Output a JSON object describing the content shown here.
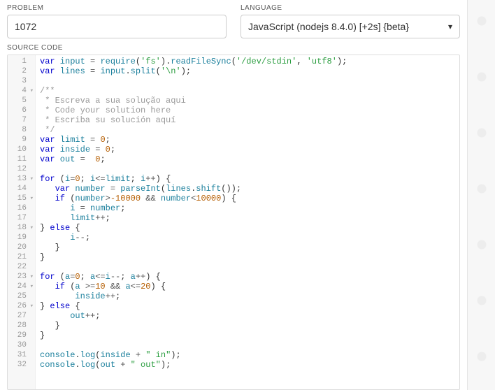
{
  "labels": {
    "problem": "PROBLEM",
    "language": "LANGUAGE",
    "source": "SOURCE CODE"
  },
  "problem_value": "1072",
  "language_value": "JavaScript (nodejs 8.4.0) [+2s] {beta}",
  "code_lines": [
    {
      "n": 1,
      "fold": false,
      "tokens": [
        [
          "kw",
          "var"
        ],
        [
          "",
          ""
        ],
        [
          "id",
          " input "
        ],
        [
          "op",
          "= "
        ],
        [
          "fn",
          "require"
        ],
        [
          "pun",
          "("
        ],
        [
          "str",
          "'fs'"
        ],
        [
          "pun",
          ")."
        ],
        [
          "fn",
          "readFileSync"
        ],
        [
          "pun",
          "("
        ],
        [
          "str",
          "'/dev/stdin'"
        ],
        [
          "pun",
          ", "
        ],
        [
          "str",
          "'utf8'"
        ],
        [
          "pun",
          ");"
        ]
      ]
    },
    {
      "n": 2,
      "fold": false,
      "tokens": [
        [
          "kw",
          "var"
        ],
        [
          "id",
          " lines "
        ],
        [
          "op",
          "= "
        ],
        [
          "id",
          "input"
        ],
        [
          "pun",
          "."
        ],
        [
          "fn",
          "split"
        ],
        [
          "pun",
          "("
        ],
        [
          "str",
          "'\\n'"
        ],
        [
          "pun",
          ");"
        ]
      ]
    },
    {
      "n": 3,
      "fold": false,
      "tokens": []
    },
    {
      "n": 4,
      "fold": true,
      "tokens": [
        [
          "cmt",
          "/**"
        ]
      ]
    },
    {
      "n": 5,
      "fold": false,
      "tokens": [
        [
          "cmt",
          " * Escreva a sua solução aqui"
        ]
      ]
    },
    {
      "n": 6,
      "fold": false,
      "tokens": [
        [
          "cmt",
          " * Code your solution here"
        ]
      ]
    },
    {
      "n": 7,
      "fold": false,
      "tokens": [
        [
          "cmt",
          " * Escriba su solución aquí"
        ]
      ]
    },
    {
      "n": 8,
      "fold": false,
      "tokens": [
        [
          "cmt",
          " */"
        ]
      ]
    },
    {
      "n": 9,
      "fold": false,
      "tokens": [
        [
          "kw",
          "var"
        ],
        [
          "id",
          " limit "
        ],
        [
          "op",
          "= "
        ],
        [
          "num",
          "0"
        ],
        [
          "pun",
          ";"
        ]
      ]
    },
    {
      "n": 10,
      "fold": false,
      "tokens": [
        [
          "kw",
          "var"
        ],
        [
          "id",
          " inside "
        ],
        [
          "op",
          "= "
        ],
        [
          "num",
          "0"
        ],
        [
          "pun",
          ";"
        ]
      ]
    },
    {
      "n": 11,
      "fold": false,
      "tokens": [
        [
          "kw",
          "var"
        ],
        [
          "id",
          " out "
        ],
        [
          "op",
          "=  "
        ],
        [
          "num",
          "0"
        ],
        [
          "pun",
          ";"
        ]
      ]
    },
    {
      "n": 12,
      "fold": false,
      "tokens": []
    },
    {
      "n": 13,
      "fold": true,
      "tokens": [
        [
          "kw",
          "for"
        ],
        [
          "pun",
          " ("
        ],
        [
          "id",
          "i"
        ],
        [
          "op",
          "="
        ],
        [
          "num",
          "0"
        ],
        [
          "pun",
          "; "
        ],
        [
          "id",
          "i"
        ],
        [
          "op",
          "<="
        ],
        [
          "id",
          "limit"
        ],
        [
          "pun",
          "; "
        ],
        [
          "id",
          "i"
        ],
        [
          "op",
          "++"
        ],
        [
          "pun",
          ") {"
        ]
      ]
    },
    {
      "n": 14,
      "fold": false,
      "tokens": [
        [
          "",
          "   "
        ],
        [
          "kw",
          "var"
        ],
        [
          "id",
          " number "
        ],
        [
          "op",
          "= "
        ],
        [
          "fn",
          "parseInt"
        ],
        [
          "pun",
          "("
        ],
        [
          "id",
          "lines"
        ],
        [
          "pun",
          "."
        ],
        [
          "fn",
          "shift"
        ],
        [
          "pun",
          "());"
        ]
      ]
    },
    {
      "n": 15,
      "fold": true,
      "tokens": [
        [
          "",
          "   "
        ],
        [
          "kw",
          "if"
        ],
        [
          "pun",
          " ("
        ],
        [
          "id",
          "number"
        ],
        [
          "op",
          ">"
        ],
        [
          "num",
          "-10000"
        ],
        [
          "op",
          " && "
        ],
        [
          "id",
          "number"
        ],
        [
          "op",
          "<"
        ],
        [
          "num",
          "10000"
        ],
        [
          "pun",
          ") {"
        ]
      ]
    },
    {
      "n": 16,
      "fold": false,
      "tokens": [
        [
          "",
          "      "
        ],
        [
          "id",
          "i "
        ],
        [
          "op",
          "= "
        ],
        [
          "id",
          "number"
        ],
        [
          "pun",
          ";"
        ]
      ]
    },
    {
      "n": 17,
      "fold": false,
      "tokens": [
        [
          "",
          "      "
        ],
        [
          "id",
          "limit"
        ],
        [
          "op",
          "++"
        ],
        [
          "pun",
          ";"
        ]
      ]
    },
    {
      "n": 18,
      "fold": true,
      "tokens": [
        [
          "pun",
          "} "
        ],
        [
          "kw",
          "else"
        ],
        [
          "pun",
          " {"
        ]
      ]
    },
    {
      "n": 19,
      "fold": false,
      "tokens": [
        [
          "",
          "      "
        ],
        [
          "id",
          "i"
        ],
        [
          "op",
          "--"
        ],
        [
          "pun",
          ";"
        ]
      ]
    },
    {
      "n": 20,
      "fold": false,
      "tokens": [
        [
          "",
          "   "
        ],
        [
          "pun",
          "}"
        ]
      ]
    },
    {
      "n": 21,
      "fold": false,
      "tokens": [
        [
          "pun",
          "}"
        ]
      ]
    },
    {
      "n": 22,
      "fold": false,
      "tokens": []
    },
    {
      "n": 23,
      "fold": true,
      "tokens": [
        [
          "kw",
          "for"
        ],
        [
          "pun",
          " ("
        ],
        [
          "id",
          "a"
        ],
        [
          "op",
          "="
        ],
        [
          "num",
          "0"
        ],
        [
          "pun",
          "; "
        ],
        [
          "id",
          "a"
        ],
        [
          "op",
          "<="
        ],
        [
          "id",
          "i"
        ],
        [
          "op",
          "--"
        ],
        [
          "pun",
          "; "
        ],
        [
          "id",
          "a"
        ],
        [
          "op",
          "++"
        ],
        [
          "pun",
          ") {"
        ]
      ]
    },
    {
      "n": 24,
      "fold": true,
      "tokens": [
        [
          "",
          "   "
        ],
        [
          "kw",
          "if"
        ],
        [
          "pun",
          " ("
        ],
        [
          "id",
          "a "
        ],
        [
          "op",
          ">="
        ],
        [
          "num",
          "10"
        ],
        [
          "op",
          " && "
        ],
        [
          "id",
          "a"
        ],
        [
          "op",
          "<="
        ],
        [
          "num",
          "20"
        ],
        [
          "pun",
          ") {"
        ]
      ]
    },
    {
      "n": 25,
      "fold": false,
      "tokens": [
        [
          "",
          "       "
        ],
        [
          "id",
          "inside"
        ],
        [
          "op",
          "++"
        ],
        [
          "pun",
          ";"
        ]
      ]
    },
    {
      "n": 26,
      "fold": true,
      "tokens": [
        [
          "pun",
          "} "
        ],
        [
          "kw",
          "else"
        ],
        [
          "pun",
          " {"
        ]
      ]
    },
    {
      "n": 27,
      "fold": false,
      "tokens": [
        [
          "",
          "      "
        ],
        [
          "id",
          "out"
        ],
        [
          "op",
          "++"
        ],
        [
          "pun",
          ";"
        ]
      ]
    },
    {
      "n": 28,
      "fold": false,
      "tokens": [
        [
          "",
          "   "
        ],
        [
          "pun",
          "}"
        ]
      ]
    },
    {
      "n": 29,
      "fold": false,
      "tokens": [
        [
          "pun",
          "}"
        ]
      ]
    },
    {
      "n": 30,
      "fold": false,
      "tokens": []
    },
    {
      "n": 31,
      "fold": false,
      "tokens": [
        [
          "id",
          "console"
        ],
        [
          "pun",
          "."
        ],
        [
          "fn",
          "log"
        ],
        [
          "pun",
          "("
        ],
        [
          "id",
          "inside "
        ],
        [
          "op",
          "+ "
        ],
        [
          "str",
          "\" in\""
        ],
        [
          "pun",
          ");"
        ]
      ]
    },
    {
      "n": 32,
      "fold": false,
      "tokens": [
        [
          "id",
          "console"
        ],
        [
          "pun",
          "."
        ],
        [
          "fn",
          "log"
        ],
        [
          "pun",
          "("
        ],
        [
          "id",
          "out "
        ],
        [
          "op",
          "+ "
        ],
        [
          "str",
          "\" out\""
        ],
        [
          "pun",
          ");"
        ]
      ]
    }
  ]
}
